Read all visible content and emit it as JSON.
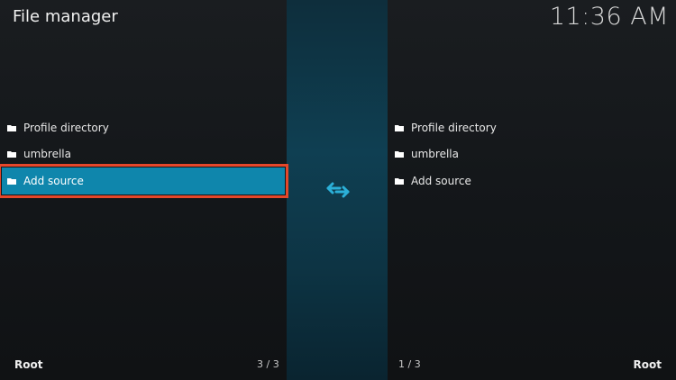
{
  "header": {
    "title": "File manager",
    "clock": "11:36 AM"
  },
  "left_pane": {
    "items": [
      {
        "label": "Profile directory",
        "icon": "folder-icon"
      },
      {
        "label": "umbrella",
        "icon": "folder-icon"
      },
      {
        "label": "Add source",
        "icon": "folder-icon",
        "selected": true
      }
    ],
    "footer_label": "Root",
    "item_count": "3 / 3"
  },
  "right_pane": {
    "items": [
      {
        "label": "Profile directory",
        "icon": "folder-icon"
      },
      {
        "label": "umbrella",
        "icon": "folder-icon"
      },
      {
        "label": "Add source",
        "icon": "folder-icon"
      }
    ],
    "footer_label": "Root",
    "item_count": "1 / 3"
  },
  "center": {
    "icon": "swap-arrows-icon"
  },
  "colors": {
    "accent": "#0f86ac",
    "highlight_outline": "#e5472a",
    "divider": "#0f3f52"
  }
}
